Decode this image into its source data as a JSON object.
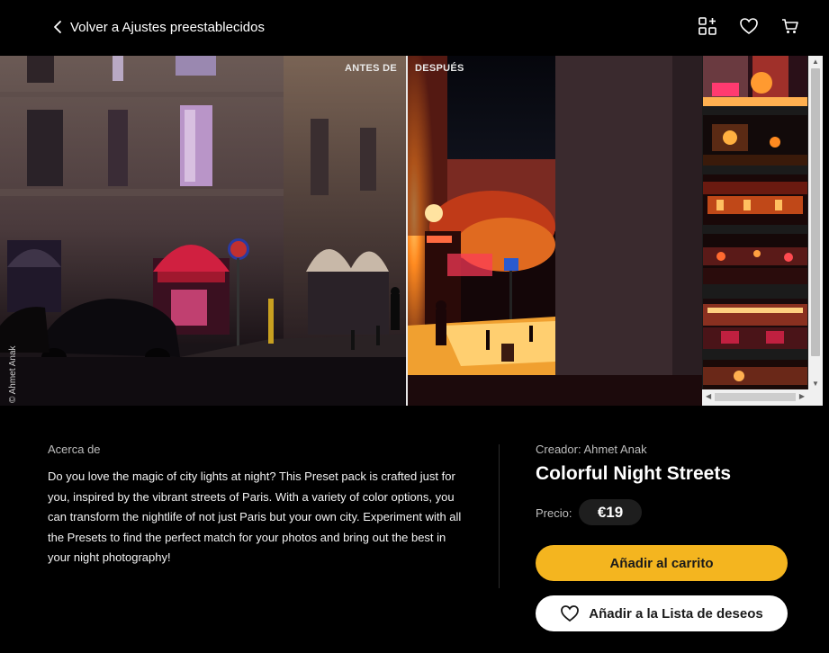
{
  "header": {
    "back_label": "Volver a Ajustes preestablecidos",
    "icons": [
      "chevron-left-icon",
      "grid-plus-icon",
      "heart-icon",
      "cart-icon"
    ]
  },
  "preview": {
    "before_label": "ANTES DE",
    "after_label": "DESPUÉS",
    "photo_credit": "© Ahmet Anak"
  },
  "thumbnails": {
    "count_visible": 6
  },
  "about": {
    "title": "Acerca de",
    "text": "Do you love the magic of city lights at night? This Preset pack is crafted just for you, inspired by the vibrant streets of Paris. With a variety of color options, you can transform the nightlife of not just Paris but your own city. Experiment with all the Presets to find the perfect match for your photos and bring out the best in your night photography!"
  },
  "product": {
    "creator": "Creador: Ahmet Anak",
    "title": "Colorful Night Streets",
    "price_label": "Precio:",
    "price": "€19",
    "add_to_cart": "Añadir al carrito",
    "add_to_wishlist": "Añadir a la Lista de deseos"
  },
  "colors": {
    "accent": "#f4b51f",
    "background": "#000000",
    "price_pill": "#1e1e1e"
  }
}
